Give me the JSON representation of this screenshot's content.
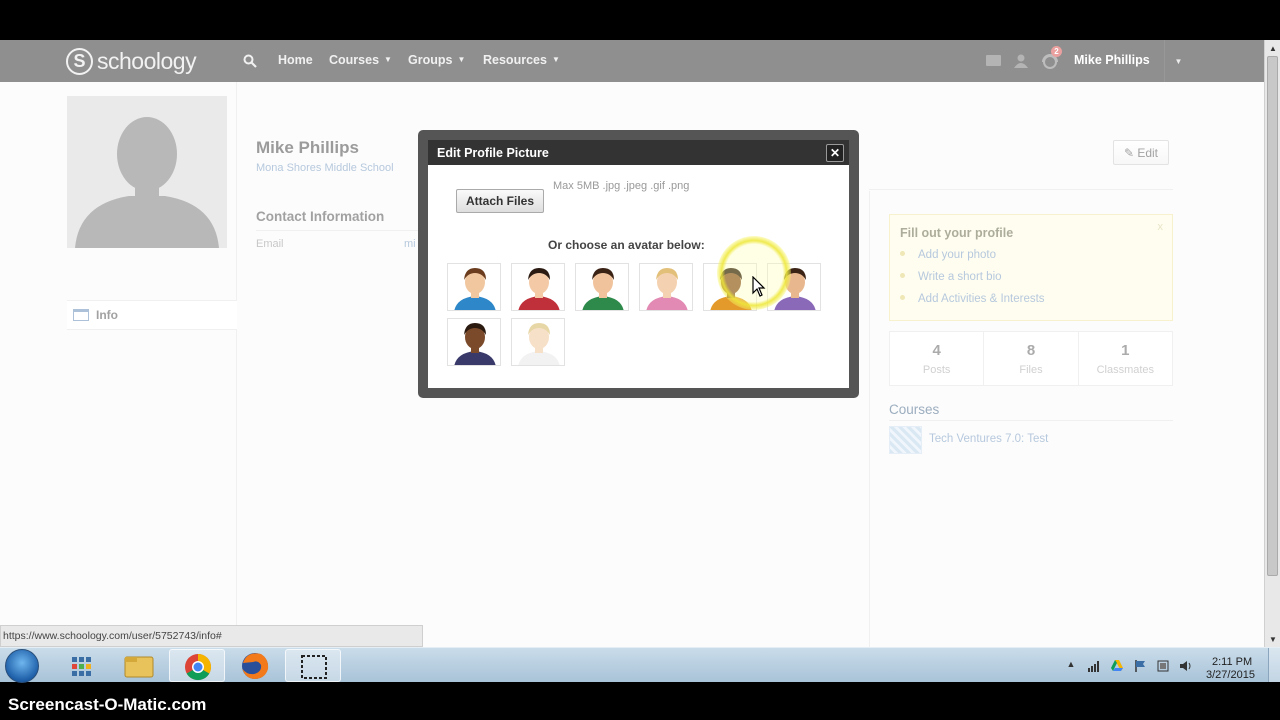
{
  "nav": {
    "logo_text": "schoology",
    "home": "Home",
    "courses": "Courses",
    "groups": "Groups",
    "resources": "Resources",
    "notification_count": "2",
    "user_name": "Mike Phillips"
  },
  "sidebar": {
    "info_label": "Info"
  },
  "profile": {
    "name": "Mike Phillips",
    "school": "Mona Shores Middle School",
    "contact_heading": "Contact Information",
    "email_label": "Email",
    "email_value": "mi",
    "edit_label": "✎ Edit"
  },
  "fill_profile": {
    "title": "Fill out your profile",
    "close": "x",
    "items": [
      "Add your photo",
      "Write a short bio",
      "Add Activities & Interests"
    ]
  },
  "stats": [
    {
      "value": "4",
      "label": "Posts"
    },
    {
      "value": "8",
      "label": "Files"
    },
    {
      "value": "1",
      "label": "Classmates"
    }
  ],
  "courses": {
    "heading": "Courses",
    "items": [
      "Tech Ventures 7.0: Test"
    ]
  },
  "modal": {
    "title": "Edit Profile Picture",
    "close": "✕",
    "attach_label": "Attach Files",
    "file_hint": "Max 5MB .jpg .jpeg .gif .png",
    "choose_label": "Or choose an avatar below:",
    "avatars": [
      {
        "skin": "#f1c7a0",
        "hair": "#6b3d1e",
        "shirt": "#2d87c8"
      },
      {
        "skin": "#f3c9a6",
        "hair": "#2a1a12",
        "shirt": "#c0303a"
      },
      {
        "skin": "#f0c39c",
        "hair": "#3a2214",
        "shirt": "#2e8a4a"
      },
      {
        "skin": "#f4d1b0",
        "hair": "#e3c07a",
        "shirt": "#e28ab3"
      },
      {
        "skin": "#8a5530",
        "hair": "#2b1a10",
        "shirt": "#e39a2a"
      },
      {
        "skin": "#e9b78e",
        "hair": "#3b2416",
        "shirt": "#8a6ab8"
      },
      {
        "skin": "#7a4a2a",
        "hair": "#2a1a10",
        "shirt": "#3a3a6a"
      },
      {
        "skin": "#f6e0c8",
        "hair": "#e8d7a6",
        "shirt": "#f2f2f2"
      }
    ]
  },
  "status_url": "https://www.schoology.com/user/5752743/info#",
  "taskbar": {
    "time": "2:11 PM",
    "date": "3/27/2015"
  },
  "watermark": "Screencast-O-Matic.com",
  "colors": {
    "nav_bg": "#333333",
    "link_blue": "#7a9cc2",
    "highlight_box": "#fefbe3"
  }
}
